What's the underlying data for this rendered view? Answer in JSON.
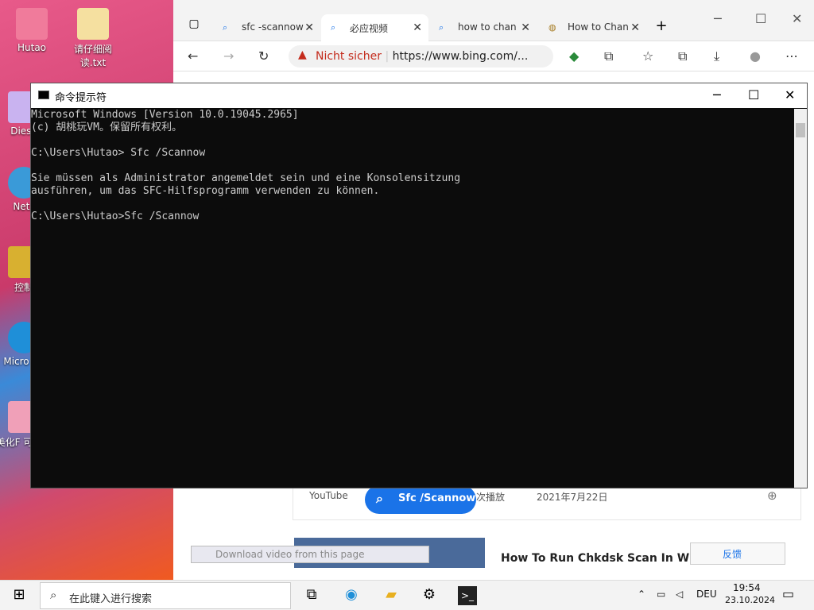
{
  "desktop": {
    "icons": [
      {
        "label": "Hutao"
      },
      {
        "label": "请仔细阅读.txt"
      },
      {
        "label": "Diese"
      },
      {
        "label": "Netz"
      },
      {
        "label": "控制"
      },
      {
        "label": "Micro Ed"
      },
      {
        "label": "美化F 可自行"
      }
    ]
  },
  "browser": {
    "tabs": [
      {
        "label": "sfc -scannow"
      },
      {
        "label": "必应视频"
      },
      {
        "label": "how to chan"
      },
      {
        "label": "How to Chan"
      }
    ],
    "url_warning": "Nicht sicher",
    "url": "https://www.bing.com/...",
    "below": {
      "source": "YouTube",
      "search_pill": "Sfc /Scannow",
      "views": "次播放",
      "date": "2021年7月22日",
      "download": "Download video from this page",
      "result_title": "How To Run Chkdsk Scan In Wind",
      "feedback": "反馈"
    }
  },
  "cmd": {
    "title": "命令提示符",
    "lines": [
      "Microsoft Windows [Version 10.0.19045.2965]",
      "(c) 胡桃玩VM。保留所有权利。",
      "",
      "C:\\Users\\Hutao> Sfc /Scannow",
      "",
      "Sie müssen als Administrator angemeldet sein und eine Konsolensitzung",
      "ausführen, um das SFC-Hilfsprogramm verwenden zu können.",
      "",
      "C:\\Users\\Hutao>Sfc /Scannow"
    ]
  },
  "taskbar": {
    "search_placeholder": "在此键入进行搜索",
    "lang": "DEU",
    "time": "19:54",
    "date": "23.10.2024"
  }
}
